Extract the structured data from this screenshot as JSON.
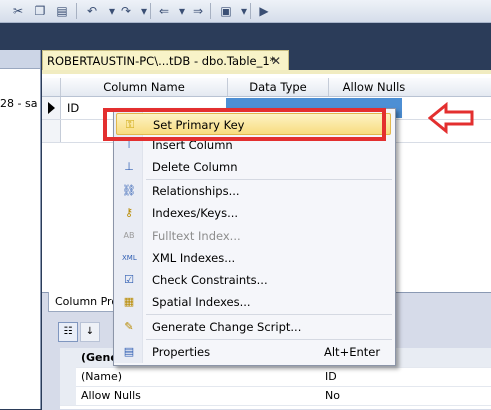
{
  "document_tab": {
    "title": "ROBERTAUSTIN-PC\\...tDB - dbo.Table_1*",
    "close": "✕"
  },
  "left_pane": {
    "snippet": "28 - sa"
  },
  "grid": {
    "columns": [
      "Column Name",
      "Data Type",
      "Allow Nulls"
    ],
    "rows": [
      {
        "name": "ID"
      }
    ]
  },
  "properties_panel": {
    "tab_label": "Column Properties",
    "rows": [
      {
        "key": "(General)",
        "value": ""
      },
      {
        "key": "(Name)",
        "value": "ID"
      },
      {
        "key": "Allow Nulls",
        "value": "No"
      }
    ]
  },
  "context_menu": {
    "items": [
      {
        "label": "Set Primary Key",
        "icon": "key-icon",
        "hovered": true
      },
      {
        "label": "Insert Column",
        "icon": "insert-column-icon"
      },
      {
        "label": "Delete Column",
        "icon": "delete-column-icon"
      },
      {
        "label": "Relationships...",
        "icon": "relationships-icon"
      },
      {
        "label": "Indexes/Keys...",
        "icon": "indexes-icon"
      },
      {
        "label": "Fulltext Index...",
        "icon": "fulltext-icon",
        "disabled": true
      },
      {
        "label": "XML Indexes...",
        "icon": "xml-icon"
      },
      {
        "label": "Check Constraints...",
        "icon": "check-icon"
      },
      {
        "label": "Spatial Indexes...",
        "icon": "spatial-icon"
      },
      {
        "label": "Generate Change Script...",
        "icon": "script-icon"
      },
      {
        "label": "Properties",
        "icon": "properties-icon",
        "shortcut": "Alt+Enter"
      }
    ]
  },
  "colors": {
    "annotation": "#e32f2f",
    "menu_hover": "#f8dc80",
    "selection": "#4d8fd4"
  }
}
